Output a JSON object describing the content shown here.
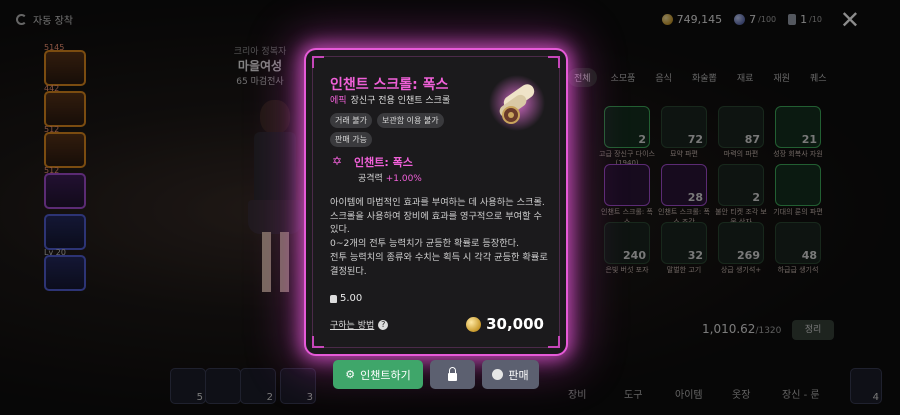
{
  "topbar": {
    "auto_equip_label": "자동 장착",
    "gold": "749,145",
    "gem": "7",
    "gem_max": "/100",
    "key": "1",
    "key_max": "/10"
  },
  "skills": {
    "labels": [
      "5145",
      "442",
      "512",
      "512",
      "",
      "Lv 20"
    ]
  },
  "character": {
    "class_title": "크리아 정복자",
    "name": "마을여성",
    "level_text": "65",
    "job": "마검전사"
  },
  "inventory": {
    "tabs": [
      "전체",
      "소모품",
      "음식",
      "화술뽑",
      "재료",
      "재원",
      "퀘스"
    ],
    "items": [
      {
        "count": "2",
        "caption": "고급 장신구 다이스(1940)"
      },
      {
        "count": "72",
        "caption": "묘약 파편"
      },
      {
        "count": "87",
        "caption": "마력의 파편"
      },
      {
        "count": "21",
        "caption": "성장 회복사 자원"
      },
      {
        "count": "",
        "caption": ""
      },
      {
        "count": "",
        "caption": "인챈트 스크롤: 폭스"
      },
      {
        "count": "28",
        "caption": "인챈트 스크롤: 폭스 조각"
      },
      {
        "count": "2",
        "caption": "불안 티켓 조각 보물 상자"
      },
      {
        "count": "",
        "caption": "기대의 룬의 파편"
      },
      {
        "count": "",
        "caption": ""
      },
      {
        "count": "240",
        "caption": "은빛 버섯 포자"
      },
      {
        "count": "32",
        "caption": "말벌한 고기"
      },
      {
        "count": "269",
        "caption": "상급 생기석+"
      },
      {
        "count": "48",
        "caption": "하급급 생기석"
      },
      {
        "count": "",
        "caption": ""
      }
    ],
    "weight": "1,010.62",
    "weight_max": "/1320",
    "sort_label": "정리"
  },
  "bottom": {
    "slot_counts": [
      "5",
      "",
      "2",
      "3",
      "4"
    ],
    "nav": [
      "장비",
      "도구",
      "아이템",
      "옷장",
      "장신 - 룬"
    ]
  },
  "tooltip": {
    "title": "인챈트 스크롤: 폭스",
    "grade": "에픽",
    "subtitle": "장신구 전용 인챈트 스크롤",
    "tags": [
      "거래 불가",
      "보관함 이용 불가",
      "판매 가능"
    ],
    "enchant_name": "인챈트: 폭스",
    "stat_label": "공격력",
    "stat_value": "+1.00%",
    "description": [
      "아이템에 마법적인 효과를 부여하는 데 사용하는 스크롤.",
      "스크롤을 사용하여 장비에 효과를 영구적으로 부여할 수 있다.",
      "0~2개의 전투 능력치가 균등한 확률로 등장한다.",
      "전투 능력치의 종류와 수치는 획득 시 각각 균등한 확률로 결정된다."
    ],
    "weight": "5.00",
    "howto_label": "구하는 방법",
    "price": "30,000"
  },
  "actions": {
    "enchant_label": "인챈트하기",
    "sell_label": "판매"
  },
  "colors": {
    "epic": "#f060d8",
    "glow": "#e65ad8",
    "primary_button": "#3fa66a",
    "secondary_button": "#5c6070"
  }
}
